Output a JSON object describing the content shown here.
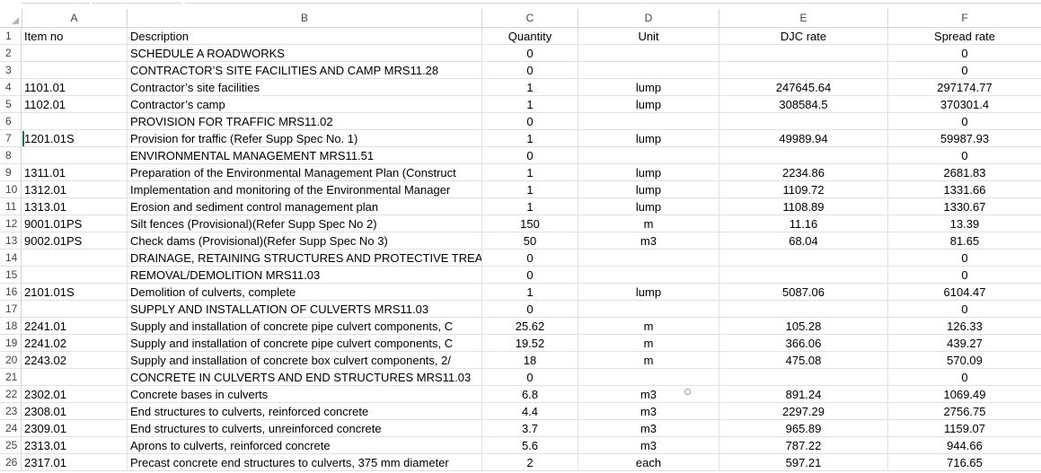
{
  "sheet": {
    "columns": [
      "A",
      "B",
      "C",
      "D",
      "E",
      "F"
    ],
    "rows": [
      {
        "n": "1",
        "a": "Item no",
        "b": "Description",
        "c": "Quantity",
        "d": "Unit",
        "e": "DJC rate",
        "f": "Spread rate"
      },
      {
        "n": "2",
        "a": "",
        "b": "SCHEDULE A ROADWORKS",
        "c": "0",
        "d": "",
        "e": "",
        "f": "0"
      },
      {
        "n": "3",
        "a": "",
        "b": "CONTRACTOR’S SITE FACILITIES AND CAMP  MRS11.28",
        "c": "0",
        "d": "",
        "e": "",
        "f": "0"
      },
      {
        "n": "4",
        "a": "1101.01",
        "b": "Contractor’s site facilities",
        "c": "1",
        "d": "lump",
        "e": "247645.64",
        "f": "297174.77"
      },
      {
        "n": "5",
        "a": "1102.01",
        "b": "Contractor’s camp",
        "c": "1",
        "d": "lump",
        "e": "308584.5",
        "f": "370301.4"
      },
      {
        "n": "6",
        "a": "",
        "b": "PROVISION FOR TRAFFIC  MRS11.02",
        "c": "0",
        "d": "",
        "e": "",
        "f": "0"
      },
      {
        "n": "7",
        "a": "1201.01S",
        "b": "Provision for traffic (Refer Supp Spec No. 1)",
        "c": "1",
        "d": "lump",
        "e": "49989.94",
        "f": "59987.93"
      },
      {
        "n": "8",
        "a": "",
        "b": "ENVIRONMENTAL MANAGEMENT  MRS11.51",
        "c": "0",
        "d": "",
        "e": "",
        "f": "0"
      },
      {
        "n": "9",
        "a": "1311.01",
        "b": "Preparation of the Environmental Management Plan (Construct",
        "c": "1",
        "d": "lump",
        "e": "2234.86",
        "f": "2681.83"
      },
      {
        "n": "10",
        "a": "1312.01",
        "b": "Implementation and monitoring of the Environmental Manager",
        "c": "1",
        "d": "lump",
        "e": "1109.72",
        "f": "1331.66"
      },
      {
        "n": "11",
        "a": "1313.01",
        "b": "Erosion and sediment control management plan",
        "c": "1",
        "d": "lump",
        "e": "1108.89",
        "f": "1330.67"
      },
      {
        "n": "12",
        "a": "9001.01PS",
        "b": "Silt fences (Provisional)(Refer Supp Spec No 2)",
        "c": "150",
        "d": "m",
        "e": "11.16",
        "f": "13.39"
      },
      {
        "n": "13",
        "a": "9002.01PS",
        "b": "Check dams (Provisional)(Refer Supp Spec No 3)",
        "c": "50",
        "d": "m3",
        "e": "68.04",
        "f": "81.65"
      },
      {
        "n": "14",
        "a": "",
        "b": "DRAINAGE, RETAINING STRUCTURES AND PROTECTIVE TREATME",
        "c": "0",
        "d": "",
        "e": "",
        "f": "0"
      },
      {
        "n": "15",
        "a": "",
        "b": "REMOVAL/DEMOLITION  MRS11.03",
        "c": "0",
        "d": "",
        "e": "",
        "f": "0"
      },
      {
        "n": "16",
        "a": "2101.01S",
        "b": "Demolition of culverts, complete",
        "c": "1",
        "d": "lump",
        "e": "5087.06",
        "f": "6104.47"
      },
      {
        "n": "17",
        "a": "",
        "b": "SUPPLY AND INSTALLATION OF CULVERTS  MRS11.03",
        "c": "0",
        "d": "",
        "e": "",
        "f": "0"
      },
      {
        "n": "18",
        "a": "2241.01",
        "b": "Supply and installation of concrete pipe culvert components, C",
        "c": "25.62",
        "d": "m",
        "e": "105.28",
        "f": "126.33"
      },
      {
        "n": "19",
        "a": "2241.02",
        "b": "Supply and installation of concrete pipe culvert components, C",
        "c": "19.52",
        "d": "m",
        "e": "366.06",
        "f": "439.27"
      },
      {
        "n": "20",
        "a": "2243.02",
        "b": "Supply and installation of concrete box culvert components, 2/",
        "c": "18",
        "d": "m",
        "e": "475.08",
        "f": "570.09"
      },
      {
        "n": "21",
        "a": "",
        "b": "CONCRETE IN CULVERTS AND END STRUCTURES  MRS11.03",
        "c": "0",
        "d": "",
        "e": "",
        "f": "0"
      },
      {
        "n": "22",
        "a": "2302.01",
        "b": "Concrete bases in culverts",
        "c": "6.8",
        "d": "m3",
        "e": "891.24",
        "f": "1069.49"
      },
      {
        "n": "23",
        "a": "2308.01",
        "b": "End structures to culverts, reinforced concrete",
        "c": "4.4",
        "d": "m3",
        "e": "2297.29",
        "f": "2756.75"
      },
      {
        "n": "24",
        "a": "2309.01",
        "b": "End structures to culverts, unreinforced concrete",
        "c": "3.7",
        "d": "m3",
        "e": "965.89",
        "f": "1159.07"
      },
      {
        "n": "25",
        "a": "2313.01",
        "b": "Aprons to culverts, reinforced concrete",
        "c": "5.6",
        "d": "m3",
        "e": "787.22",
        "f": "944.66"
      },
      {
        "n": "26",
        "a": "2317.01",
        "b": "Precast concrete end structures to culverts, 375 mm diameter",
        "c": "2",
        "d": "each",
        "e": "597.21",
        "f": "716.65"
      }
    ]
  }
}
